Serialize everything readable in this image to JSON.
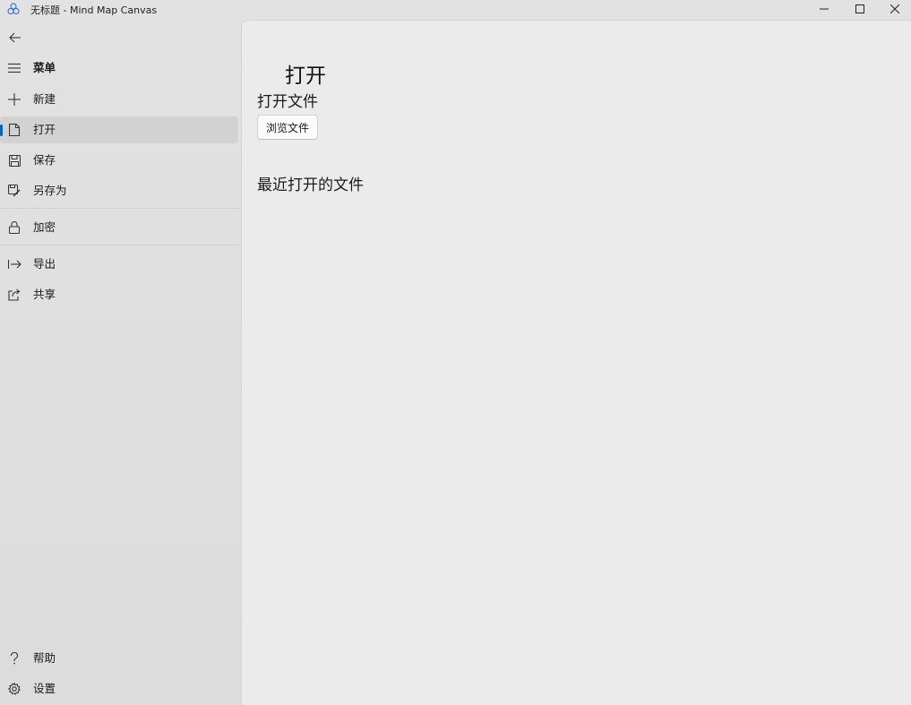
{
  "window": {
    "title": "无标题 - Mind Map Canvas"
  },
  "sidebar": {
    "items": [
      {
        "label": "菜单",
        "icon": "hamburger-icon"
      },
      {
        "label": "新建",
        "icon": "plus-icon"
      },
      {
        "label": "打开",
        "icon": "document-icon",
        "selected": true
      },
      {
        "label": "保存",
        "icon": "save-icon"
      },
      {
        "label": "另存为",
        "icon": "save-as-icon"
      },
      {
        "label": "加密",
        "icon": "lock-icon"
      },
      {
        "label": "导出",
        "icon": "export-icon"
      },
      {
        "label": "共享",
        "icon": "share-icon"
      },
      {
        "label": "帮助",
        "icon": "help-icon"
      },
      {
        "label": "设置",
        "icon": "gear-icon"
      }
    ]
  },
  "main": {
    "page_title": "打开",
    "open_file_heading": "打开文件",
    "browse_button": "浏览文件",
    "recent_heading": "最近打开的文件"
  },
  "colors": {
    "accent": "#0067c0",
    "sidebar_bg": "#dedede",
    "content_bg": "#ebebeb",
    "selected_bg": "#d2d2d2"
  }
}
